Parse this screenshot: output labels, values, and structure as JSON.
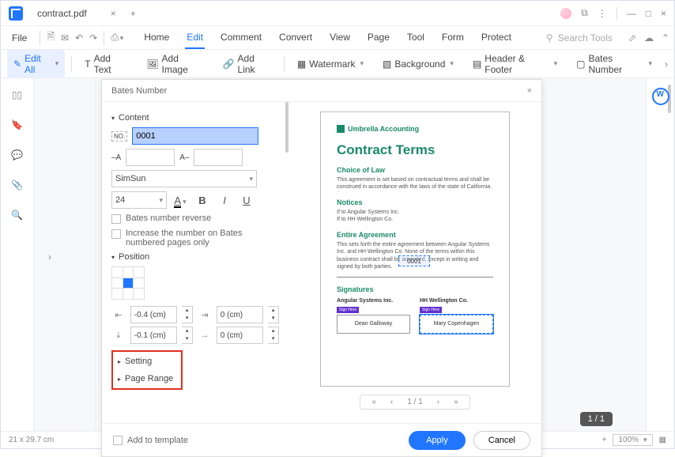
{
  "titlebar": {
    "tab": "contract.pdf"
  },
  "menubar": {
    "file": "File",
    "tabs": [
      "Home",
      "Edit",
      "Comment",
      "Convert",
      "View",
      "Page",
      "Tool",
      "Form",
      "Protect"
    ],
    "active": 1,
    "search_placeholder": "Search Tools"
  },
  "toolbar": {
    "edit_all": "Edit All",
    "add_text": "Add Text",
    "add_image": "Add Image",
    "add_link": "Add Link",
    "watermark": "Watermark",
    "background": "Background",
    "header_footer": "Header & Footer",
    "bates_number": "Bates Number"
  },
  "dialog": {
    "title": "Bates Number",
    "content": "Content",
    "start_number": "0001",
    "font": "SimSun",
    "size": "24",
    "bates_reverse": "Bates number reverse",
    "increase_only": "Increase the number on Bates numbered pages only",
    "position": "Position",
    "offset_x": "-0.4 (cm)",
    "offset_y": "-0.1 (cm)",
    "offset_zero": "0 (cm)",
    "setting": "Setting",
    "page_range": "Page Range",
    "add_to_template": "Add to template",
    "apply": "Apply",
    "cancel": "Cancel",
    "nav_page": "1 / 1"
  },
  "preview": {
    "company": "Umbrella Accounting",
    "title": "Contract Terms",
    "h1": "Choice of Law",
    "p1": "This agreement is set based on contractual terms and shall be construed in accordance with the laws of the state of California.",
    "h2": "Notices",
    "p2a": "If to Angular Systems Inc.",
    "p2b": "If to HH Wellington Co.",
    "bates": "0001",
    "h3": "Entire Agreement",
    "p3": "This sets forth the entire agreement between Angular Systems Inc. and HH Wellington Co. None of the terms within this business contract shall be amended, except in writing and signed by both parties.",
    "h4": "Signatures",
    "sig1_h": "Angular Systems Inc.",
    "sig1_tag": "Sign Here",
    "sig1_name": "Dean Galloway",
    "sig2_h": "HH Wellington Co.",
    "sig2_tag": "Sign Here",
    "sig2_name": "Mary Copenhagen"
  },
  "page_badge": "1 / 1",
  "statusbar": {
    "dims": "21 x 29.7 cm",
    "zoom": "100%"
  }
}
